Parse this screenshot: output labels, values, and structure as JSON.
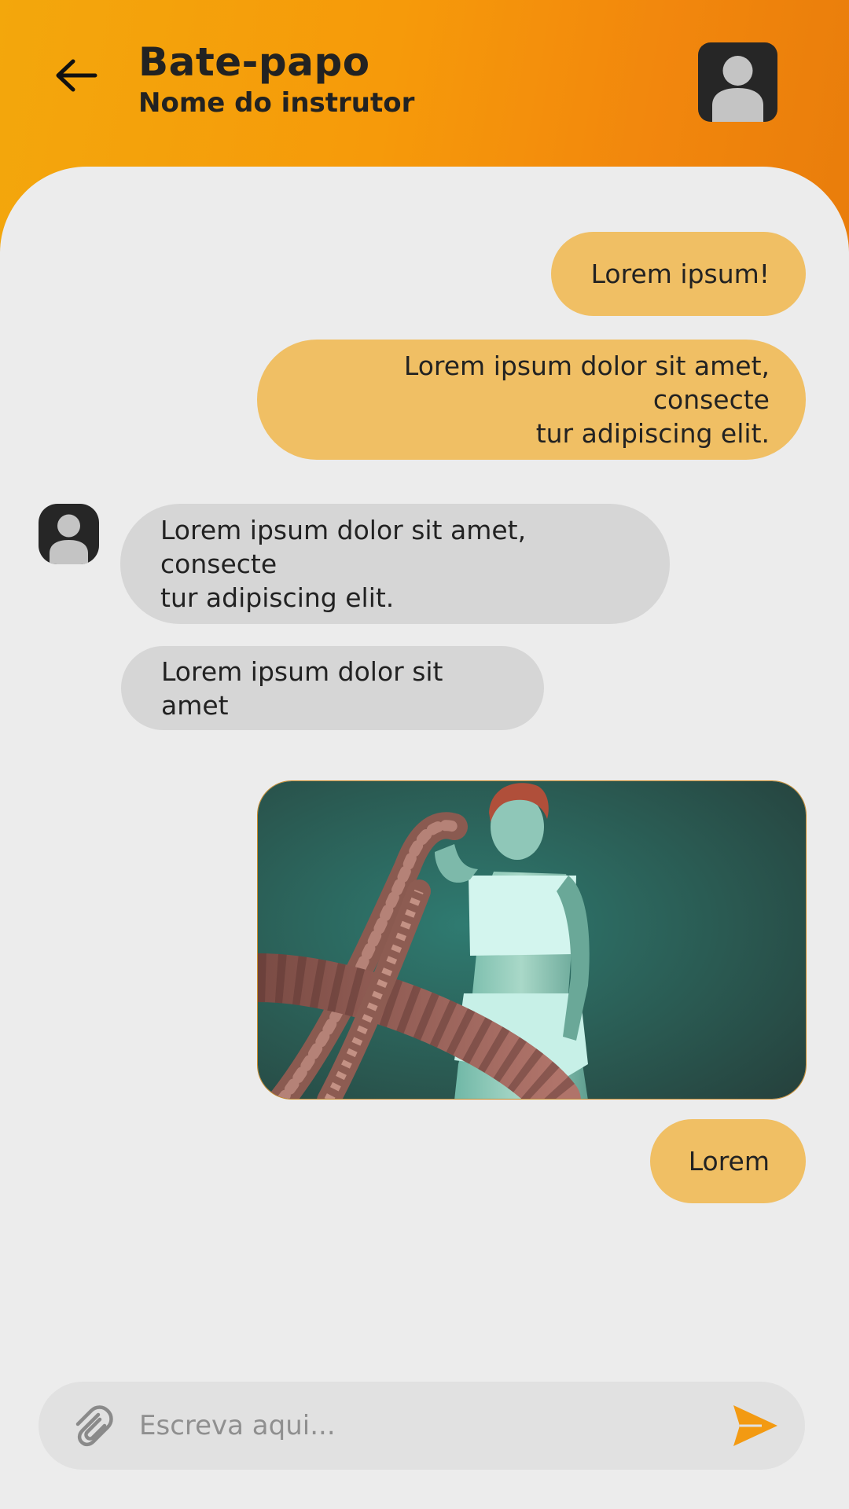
{
  "header": {
    "title": "Bate-papo",
    "subtitle": "Nome do instrutor",
    "back_icon": "arrow-left-icon",
    "avatar_icon": "user-avatar-icon"
  },
  "messages": [
    {
      "side": "sent",
      "text": "Lorem ipsum!"
    },
    {
      "side": "sent",
      "text": "Lorem ipsum dolor sit amet, consecte tur adipiscing elit.",
      "lines": [
        "Lorem ipsum dolor sit amet, consecte",
        "tur adipiscing elit."
      ]
    },
    {
      "side": "received",
      "text": "Lorem ipsum dolor sit amet, consecte tur adipiscing elit.",
      "lines": [
        "Lorem ipsum dolor sit amet, consecte",
        "tur adipiscing elit."
      ]
    },
    {
      "side": "received",
      "text": "Lorem ipsum dolor sit amet"
    },
    {
      "side": "sent",
      "type": "image",
      "alt": "photo-woman-battle-ropes"
    },
    {
      "side": "sent",
      "text": "Lorem"
    }
  ],
  "composer": {
    "placeholder": "Escreva aqui...",
    "value": "",
    "attach_icon": "paperclip-icon",
    "send_icon": "send-icon"
  },
  "colors": {
    "header_gradient_start": "#f3a70c",
    "header_gradient_end": "#e97d0b",
    "sent_bubble": "#f0bf64",
    "received_bubble": "#d6d6d6",
    "background": "#ececec",
    "input_bar": "#e1e1e1",
    "send_icon": "#f39a12",
    "text": "#222222"
  }
}
